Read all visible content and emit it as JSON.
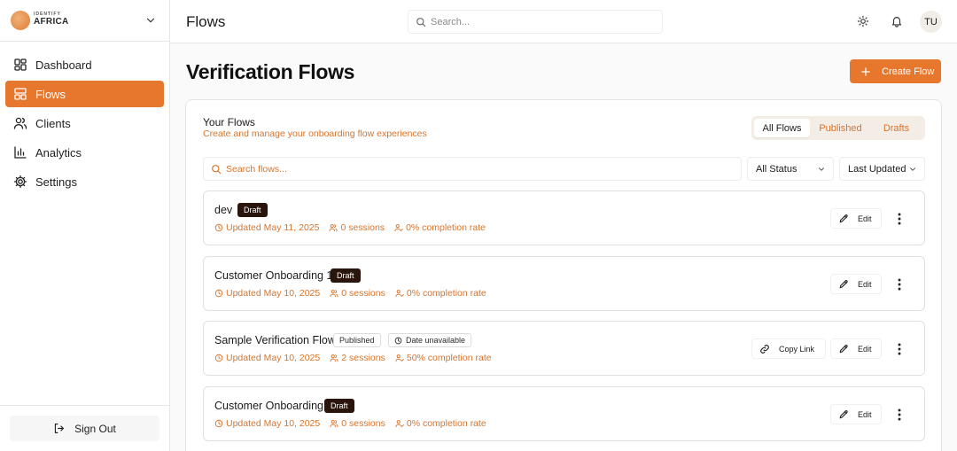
{
  "brand": {
    "line1": "IDENTIFY",
    "line2": "AFRICA"
  },
  "sidebar": {
    "items": [
      {
        "label": "Dashboard",
        "icon": "dashboard-icon",
        "active": false
      },
      {
        "label": "Flows",
        "icon": "flows-icon",
        "active": true
      },
      {
        "label": "Clients",
        "icon": "users-icon",
        "active": false
      },
      {
        "label": "Analytics",
        "icon": "analytics-icon",
        "active": false
      },
      {
        "label": "Settings",
        "icon": "gear-icon",
        "active": false
      }
    ],
    "signout_label": "Sign Out"
  },
  "header": {
    "title": "Flows",
    "search_placeholder": "Search...",
    "avatar_initials": "TU"
  },
  "main": {
    "title": "Verification Flows",
    "create_label": "Create Flow",
    "panel_title": "Your Flows",
    "panel_subtitle": "Create and manage your onboarding flow experiences",
    "tabs": [
      {
        "label": "All Flows",
        "active": true
      },
      {
        "label": "Published",
        "active": false
      },
      {
        "label": "Drafts",
        "active": false
      }
    ],
    "search_placeholder": "Search flows...",
    "status_filter": "All Status",
    "sort_filter": "Last Updated",
    "flows": [
      {
        "name": "dev",
        "badge": "Draft",
        "updated": "Updated May 11, 2025",
        "sessions": "0 sessions",
        "completion": "0% completion rate",
        "edit_label": "Edit"
      },
      {
        "name": "Customer Onboarding 1",
        "badge": "Draft",
        "updated": "Updated May 10, 2025",
        "sessions": "0 sessions",
        "completion": "0% completion rate",
        "edit_label": "Edit"
      },
      {
        "name": "Sample Verification Flow",
        "badge": "Published",
        "date_badge": "Date unavailable",
        "updated": "Updated May 10, 2025",
        "sessions": "2 sessions",
        "completion": "50% completion rate",
        "copy_label": "Copy Link",
        "edit_label": "Edit"
      },
      {
        "name": "Customer Onboarding",
        "badge": "Draft",
        "updated": "Updated May 10, 2025",
        "sessions": "0 sessions",
        "completion": "0% completion rate",
        "edit_label": "Edit"
      }
    ]
  },
  "colors": {
    "accent": "#e8772e",
    "accent_text": "#d6742d",
    "draft_badge": "#2a150c"
  }
}
